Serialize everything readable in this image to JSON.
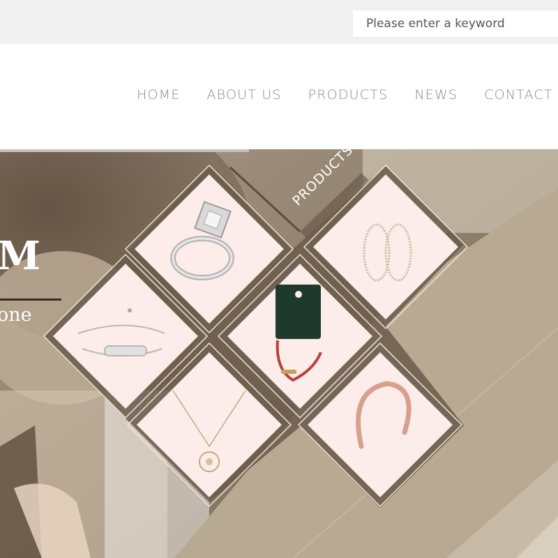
{
  "search": {
    "placeholder": "Please enter a keyword"
  },
  "nav": {
    "items": [
      {
        "label": "HOME"
      },
      {
        "label": "ABOUT US"
      },
      {
        "label": "PRODUCTS"
      },
      {
        "label": "NEWS"
      },
      {
        "label": "CONTACT US"
      }
    ]
  },
  "hero": {
    "title": "M",
    "subtitle": "one",
    "products_label": "PRODUCTS"
  },
  "products": [
    {
      "name": "ring-product",
      "icon": "ring-icon"
    },
    {
      "name": "hoop-earrings-product",
      "icon": "earrings-icon"
    },
    {
      "name": "bracelet-product",
      "icon": "bracelet-icon"
    },
    {
      "name": "red-string-bracelet-product",
      "icon": "string-bracelet-icon"
    },
    {
      "name": "pendant-necklace-product",
      "icon": "necklace-icon"
    },
    {
      "name": "bangle-product",
      "icon": "bangle-icon"
    }
  ],
  "colors": {
    "tile_background": "#fcecea",
    "hero_overlay": "#b8aa92",
    "nav_text": "#888888",
    "topbar": "#f0f0f0"
  }
}
